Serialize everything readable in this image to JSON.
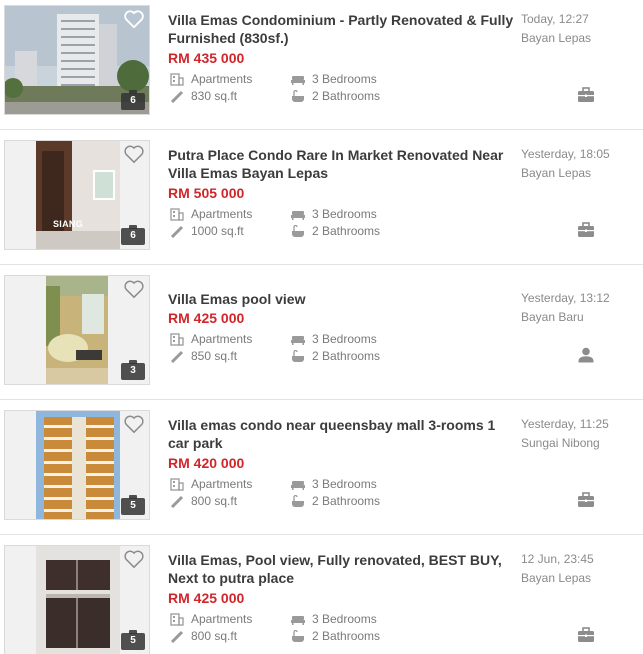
{
  "listings": [
    {
      "title": "Villa Emas Condominium - Partly Renovated & Fully Furnished (830sf.)",
      "price": "RM 435 000",
      "type": "Apartments",
      "size": "830 sq.ft",
      "bedrooms": "3 Bedrooms",
      "bathrooms": "2 Bathrooms",
      "date": "Today, 12:27",
      "location": "Bayan Lepas",
      "photo_count": "6",
      "seller_icon": "briefcase-icon"
    },
    {
      "title": "Putra Place Condo Rare In Market Renovated Near Villa Emas Bayan Lepas",
      "price": "RM 505 000",
      "type": "Apartments",
      "size": "1000 sq.ft",
      "bedrooms": "3 Bedrooms",
      "bathrooms": "2 Bathrooms",
      "date": "Yesterday, 18:05",
      "location": "Bayan Lepas",
      "photo_count": "6",
      "photo_text": "SIANG",
      "seller_icon": "briefcase-icon"
    },
    {
      "title": "Villa Emas pool view",
      "price": "RM 425 000",
      "type": "Apartments",
      "size": "850 sq.ft",
      "bedrooms": "3 Bedrooms",
      "bathrooms": "2 Bathrooms",
      "date": "Yesterday, 13:12",
      "location": "Bayan Baru",
      "photo_count": "3",
      "seller_icon": "person-icon"
    },
    {
      "title": "Villa emas condo near queensbay mall 3-rooms 1 car park",
      "price": "RM 420 000",
      "type": "Apartments",
      "size": "800 sq.ft",
      "bedrooms": "3 Bedrooms",
      "bathrooms": "2 Bathrooms",
      "date": "Yesterday, 11:25",
      "location": "Sungai Nibong",
      "photo_count": "5",
      "seller_icon": "briefcase-icon"
    },
    {
      "title": "Villa Emas, Pool view, Fully renovated, BEST BUY, Next to putra place",
      "price": "RM 425 000",
      "type": "Apartments",
      "size": "800 sq.ft",
      "bedrooms": "3 Bedrooms",
      "bathrooms": "2 Bathrooms",
      "date": "12 Jun, 23:45",
      "location": "Bayan Lepas",
      "photo_count": "5",
      "seller_icon": "briefcase-icon"
    }
  ],
  "colors": {
    "price": "#d0262a",
    "icon": "#8c8c8c",
    "text_muted": "#8a8a8a"
  }
}
